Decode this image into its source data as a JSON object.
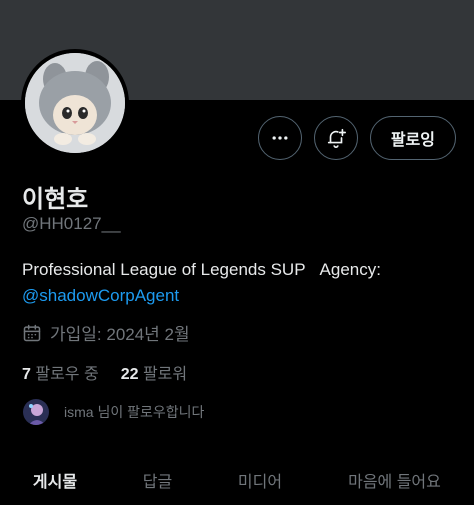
{
  "profile": {
    "name": "이현호",
    "handle": "@HH0127__",
    "bio_text": "Professional League of Legends SUP",
    "bio_agency": "Agency:",
    "bio_mention": "@shadowCorpAgent",
    "joined": "가입일: 2024년 2월",
    "following_count": "7",
    "following_label": "팔로우 중",
    "followers_count": "22",
    "followers_label": "팔로워",
    "followed_by": "isma 님이 팔로우합니다"
  },
  "actions": {
    "more_icon": "more-horizontal-icon",
    "notify_icon": "bell-plus-icon",
    "follow_label": "팔로잉"
  },
  "tabs": [
    {
      "label": "게시물",
      "active": true
    },
    {
      "label": "답글",
      "active": false
    },
    {
      "label": "미디어",
      "active": false
    },
    {
      "label": "마음에 들어요",
      "active": false
    }
  ],
  "colors": {
    "background": "#000000",
    "banner": "#333639",
    "accent": "#1d9bf0",
    "muted": "#71767b"
  }
}
